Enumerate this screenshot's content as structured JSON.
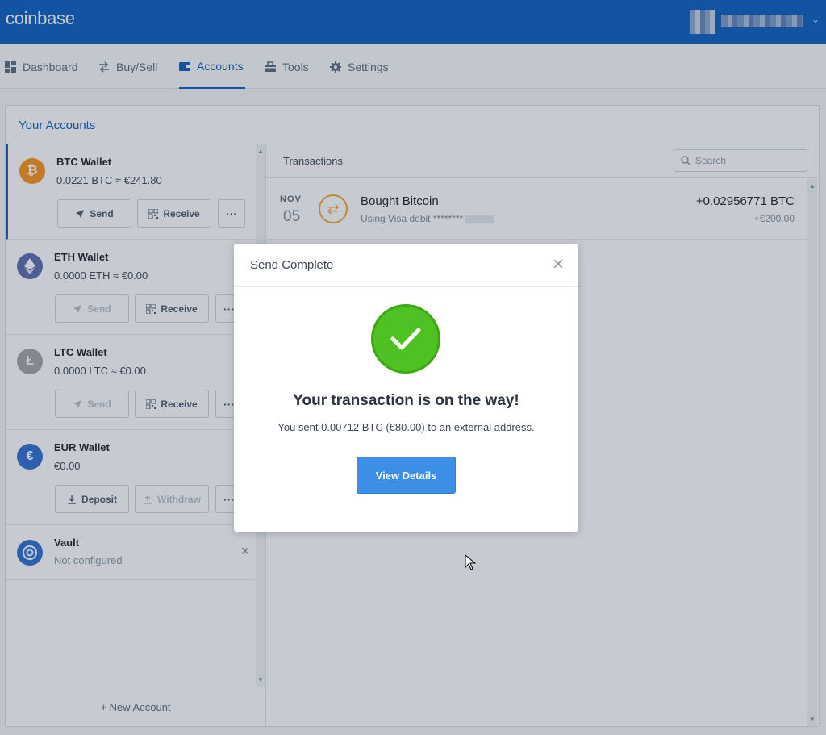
{
  "app": {
    "logo": "coinbase"
  },
  "user": {
    "avatar_icon": "avatar-image",
    "caret": "⌄"
  },
  "nav": {
    "items": [
      {
        "label": "Dashboard",
        "icon": "dashboard-icon"
      },
      {
        "label": "Buy/Sell",
        "icon": "exchange-icon"
      },
      {
        "label": "Accounts",
        "icon": "wallet-icon",
        "active": true
      },
      {
        "label": "Tools",
        "icon": "toolbox-icon"
      },
      {
        "label": "Settings",
        "icon": "gear-icon"
      }
    ]
  },
  "accounts": {
    "title": "Your Accounts",
    "wallets": [
      {
        "name": "BTC Wallet",
        "balance": "0.0221 BTC ≈ €241.80",
        "icon": "bitcoin-icon",
        "color": "#f7931a",
        "btn1": "Send",
        "btn2": "Receive",
        "btn1_disabled": false
      },
      {
        "name": "ETH Wallet",
        "balance": "0.0000 ETH ≈ €0.00",
        "icon": "ethereum-icon",
        "color": "#5d6bb0",
        "btn1": "Send",
        "btn2": "Receive",
        "btn1_disabled": true
      },
      {
        "name": "LTC Wallet",
        "balance": "0.0000 LTC ≈ €0.00",
        "icon": "litecoin-icon",
        "color": "#a5a5a5",
        "btn1": "Send",
        "btn2": "Receive",
        "btn1_disabled": true
      },
      {
        "name": "EUR Wallet",
        "balance": "€0.00",
        "icon": "euro-icon",
        "color": "#2f6fd0",
        "btn1": "Deposit",
        "btn2": "Withdraw",
        "btn2_disabled": true
      }
    ],
    "vault": {
      "name": "Vault",
      "status": "Not configured",
      "icon": "vault-icon",
      "close": "×"
    },
    "more_label": "···",
    "new_account": "+ New Account"
  },
  "transactions": {
    "title": "Transactions",
    "search_placeholder": "Search",
    "rows": [
      {
        "month": "NOV",
        "day": "05",
        "title": "Bought Bitcoin",
        "subtitle": "Using Visa debit ********",
        "amount": "+0.02956771 BTC",
        "fiat": "+€200.00"
      }
    ]
  },
  "modal": {
    "title": "Send Complete",
    "close": "×",
    "heading": "Your transaction is on the way!",
    "message": "You sent 0.00712 BTC (€80.00) to an external address.",
    "button": "View Details"
  }
}
